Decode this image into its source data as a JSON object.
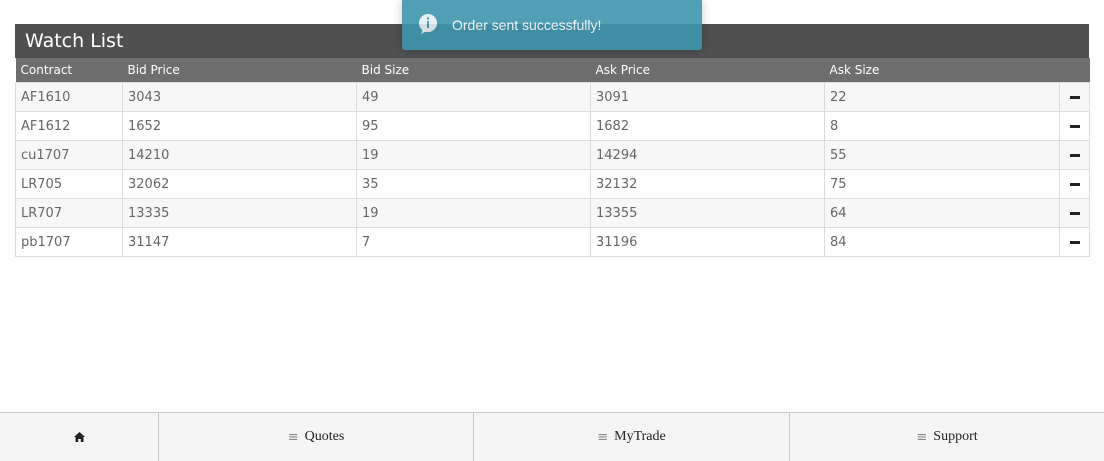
{
  "toast": {
    "message": "Order sent successfully!",
    "icon": "info-bubble-icon"
  },
  "watchlist": {
    "title": "Watch List",
    "columns": [
      "Contract",
      "Bid Price",
      "Bid Size",
      "Ask Price",
      "Ask Size"
    ],
    "rows": [
      {
        "contract": "AF1610",
        "bid_price": "3043",
        "bid_size": "49",
        "ask_price": "3091",
        "ask_size": "22"
      },
      {
        "contract": "AF1612",
        "bid_price": "1652",
        "bid_size": "95",
        "ask_price": "1682",
        "ask_size": "8"
      },
      {
        "contract": "cu1707",
        "bid_price": "14210",
        "bid_size": "19",
        "ask_price": "14294",
        "ask_size": "55"
      },
      {
        "contract": "LR705",
        "bid_price": "32062",
        "bid_size": "35",
        "ask_price": "32132",
        "ask_size": "75"
      },
      {
        "contract": "LR707",
        "bid_price": "13335",
        "bid_size": "19",
        "ask_price": "13355",
        "ask_size": "64"
      },
      {
        "contract": "pb1707",
        "bid_price": "31147",
        "bid_size": "7",
        "ask_price": "31196",
        "ask_size": "84"
      }
    ],
    "row_action_icon": "minus-icon"
  },
  "nav": {
    "home_icon": "home-icon",
    "menu_icon": "menu-icon",
    "quotes_label": "Quotes",
    "mytrade_label": "MyTrade",
    "support_label": "Support"
  },
  "colors": {
    "title_bar": "#505050",
    "header_bar": "#6e6e6e",
    "toast": "#3e95ad"
  }
}
